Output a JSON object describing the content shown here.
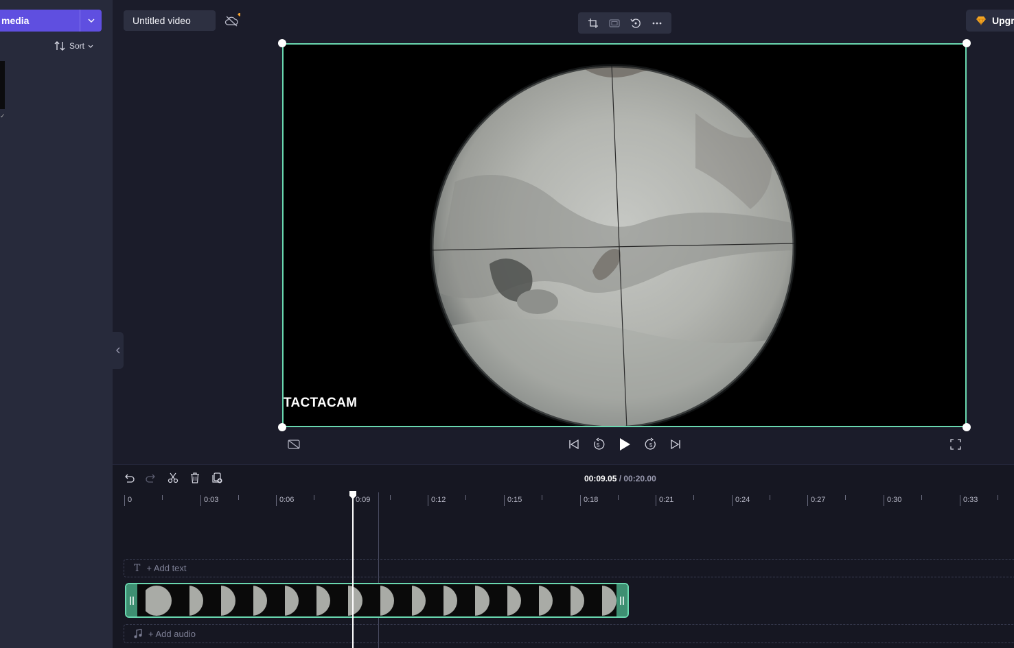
{
  "app": {
    "media_button": "media",
    "sort_label": "Sort",
    "project_title": "Untitled video",
    "upgrade_label": "Upgr",
    "accent": "#5f4fe0",
    "selection": "#6ad8b0"
  },
  "preview": {
    "watermark": "TACTACAM",
    "toolbar_icons": [
      "crop-icon",
      "fit-icon",
      "rotate-icon",
      "more-icon"
    ]
  },
  "timeline": {
    "current_time": "00:09.05",
    "total_time": "/ 00:20.00",
    "ruler": [
      "0",
      "0:03",
      "0:06",
      "0:09",
      "0:12",
      "0:15",
      "0:18",
      "0:21",
      "0:24",
      "0:27",
      "0:30",
      "0:33"
    ],
    "add_text": "+ Add text",
    "add_audio": "+ Add audio"
  }
}
